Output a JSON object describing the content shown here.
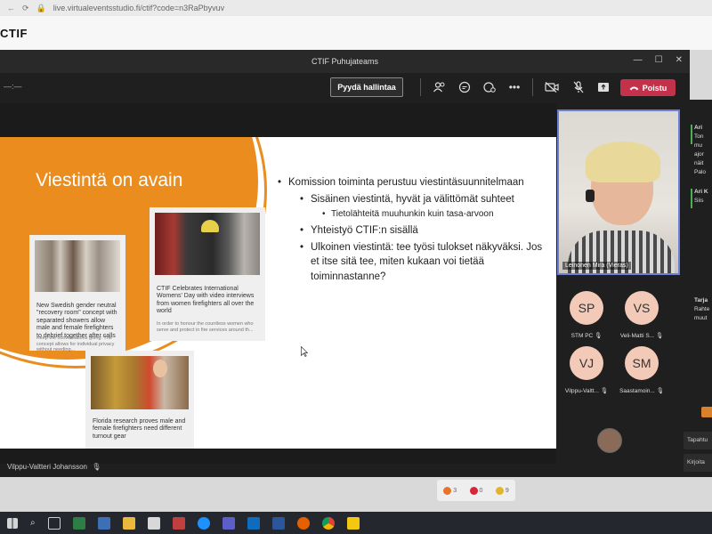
{
  "browser": {
    "url": "live.virtualeventsstudio.fi/ctif?code=n3RaPbyvuv"
  },
  "site": {
    "logo": "CTIF"
  },
  "window": {
    "title": "CTIF Puhujateams"
  },
  "toolbar": {
    "left_label": "—:—",
    "take_control": "Pyydä hallintaa",
    "leave": "Poistu"
  },
  "slide": {
    "title": "Viestintä on avain",
    "cards": [
      {
        "caption": "New Swedish gender neutral \"recovery room\" concept with separated showers allow male and female firefighters to debrief together after calls",
        "sub": "Keep the conversations going: The concept allows for individual privacy without needing..."
      },
      {
        "caption": "CTIF Celebrates International Womens' Day with video interviews from women firefighters all over the world",
        "sub": "In order to honour the countless women who serve and protect in fire services around th..."
      },
      {
        "caption": "Florida research proves male and female firefighters need different turnout gear",
        "sub": ""
      }
    ],
    "bullets": [
      {
        "level": 1,
        "text": "Komission toiminta perustuu viestintäsuunnitelmaan"
      },
      {
        "level": 2,
        "text": "Sisäinen viestintä, hyvät ja välittömät suhteet"
      },
      {
        "level": 3,
        "text": "Tietolähteitä muuhunkin kuin tasa-arvoon"
      },
      {
        "level": 2,
        "text": "Yhteistyö CTIF:n sisällä"
      },
      {
        "level": 2,
        "text": "Ulkoinen viestintä: tee työsi tulokset näkyväksi. Jos et itse sitä tee, miten kukaan voi tietää toiminnastanne?"
      }
    ]
  },
  "presenter": "Vilppu-Valtteri Johansson",
  "video": {
    "name": "Leinonen Mira (Vieras)"
  },
  "participants": [
    {
      "initials": "SP",
      "label": "STM PC"
    },
    {
      "initials": "VS",
      "label": "Veli-Matti S..."
    },
    {
      "initials": "VJ",
      "label": "Vilppu-Valtt..."
    },
    {
      "initials": "SM",
      "label": "Saastamoin..."
    }
  ],
  "chat": {
    "messages": [
      "Ari",
      "Ton",
      "mu",
      "ajor",
      "näit",
      "Palo",
      "Ari K",
      "Siis",
      "Tarja",
      "Rahte",
      "muut"
    ],
    "inputs": [
      "Tapahtu",
      "Kirjoita"
    ]
  },
  "reactions": [
    {
      "icon": "fire-icon",
      "count": "3",
      "color": "#e8742b"
    },
    {
      "icon": "heart-icon",
      "count": "0",
      "color": "#d6263b"
    },
    {
      "icon": "clap-icon",
      "count": "9",
      "color": "#e5b22c"
    }
  ],
  "colors": {
    "accent": "#ea8c1e",
    "leave": "#c4314b",
    "tile_border": "#6b7fd7"
  }
}
